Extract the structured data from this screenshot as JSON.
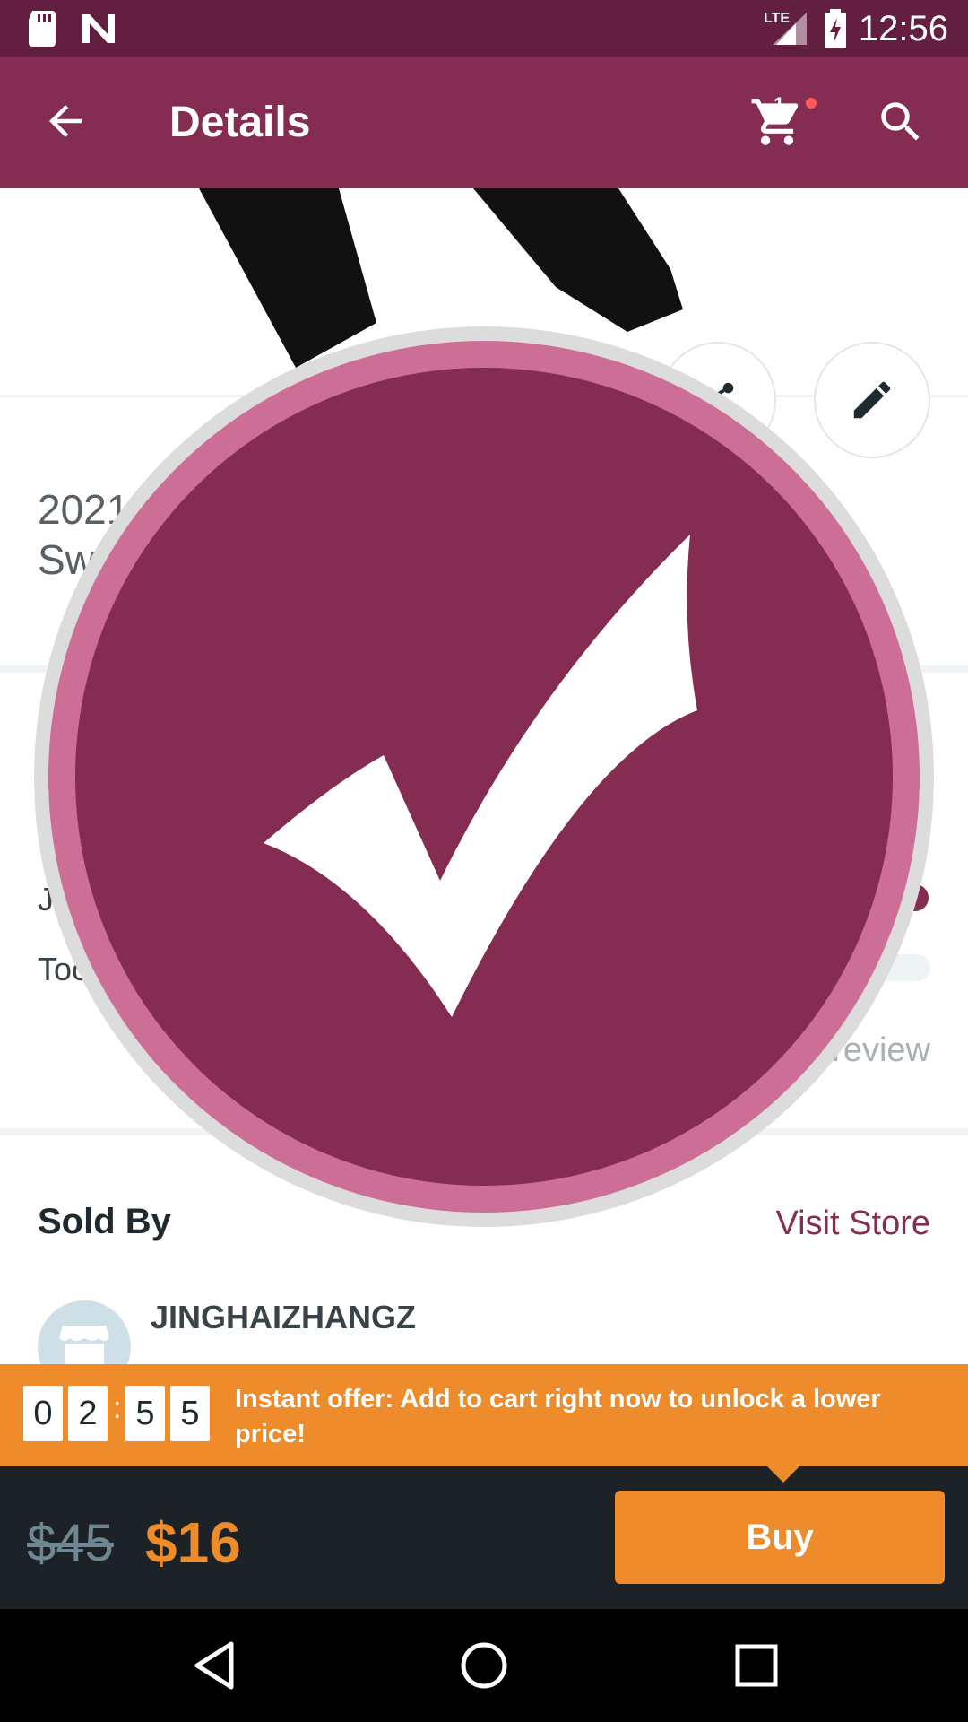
{
  "status_bar": {
    "time": "12:56",
    "network": "LTE"
  },
  "app_bar": {
    "title": "Details",
    "cart_count": "1"
  },
  "product": {
    "title_line1": "2021",
    "title_line2": "Sw"
  },
  "reviews": {
    "reviewer_fragment": "J",
    "text_fragment": "Too",
    "link_fragment": "review"
  },
  "seller": {
    "section_label": "Sold By",
    "visit_store_label": "Visit Store",
    "store_name": "JINGHAIZHANGZ"
  },
  "offer": {
    "countdown": [
      "0",
      "2",
      "5",
      "5"
    ],
    "separator": ":",
    "message": "Instant offer: Add to cart right now to unlock a lower price!"
  },
  "purchase": {
    "original_price": "$45",
    "sale_price": "$16",
    "buy_label": "Buy"
  },
  "colors": {
    "brand": "#852c52",
    "status_bar": "#631f3f",
    "accent": "#ee8b2b",
    "overlay_ring": "#cc6e96"
  },
  "icons": {
    "back": "back-arrow-icon",
    "cart": "cart-icon",
    "search": "search-icon",
    "share": "share-icon",
    "edit": "pencil-icon",
    "success": "checkmark-icon"
  }
}
